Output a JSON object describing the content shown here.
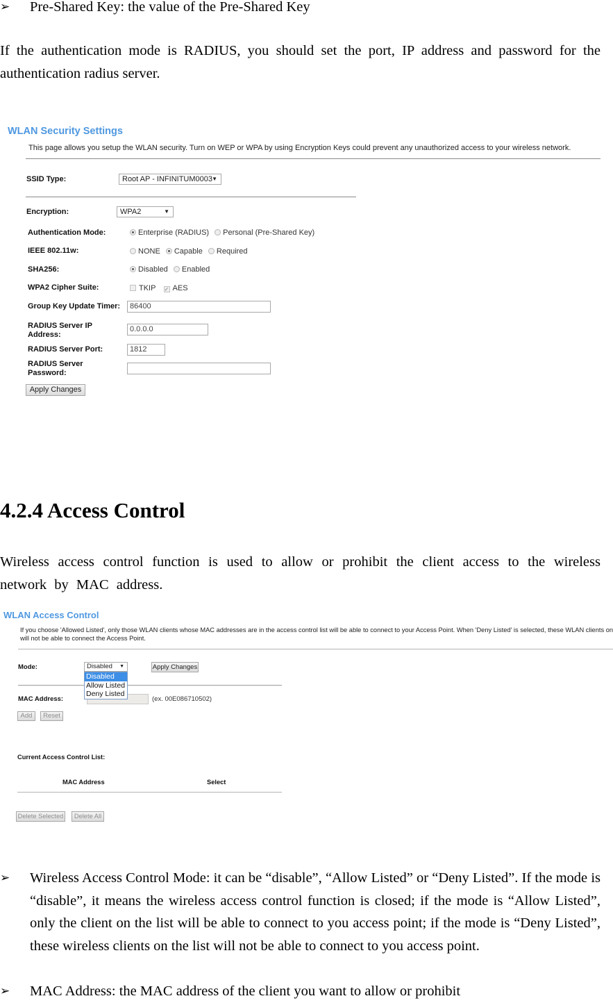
{
  "doc": {
    "bullet_glyph": "➢",
    "intro_bullet": "Pre-Shared Key: the value of the Pre-Shared Key",
    "radius_paragraph": "If the authentication mode is RADIUS, you should set the port, IP address and password for the authentication radius server.",
    "section_heading": "4.2.4 Access Control",
    "access_paragraph": "Wireless access control function is used to allow or prohibit the client access to the wireless network by MAC address.",
    "bullets": [
      "Wireless Access Control Mode: it can be “disable”, “Allow Listed” or “Deny Listed”. If the mode is “disable”, it means the wireless access control function is closed; if the mode is “Allow Listed”, only the client on the list will be able to connect to you access point; if the mode is “Deny Listed”, these wireless clients on the list will not be able to connect to you access point.",
      "MAC Address: the MAC address of the client you want to allow or prohibit"
    ]
  },
  "security": {
    "title": "WLAN Security Settings",
    "description": "This page allows you setup the WLAN security. Turn on WEP or WPA by using Encryption Keys could prevent any unauthorized access to your wireless network.",
    "ssid_type": {
      "label": "SSID Type:",
      "value": "Root AP - INFINITUM0003"
    },
    "encryption": {
      "label": "Encryption:",
      "value": "WPA2"
    },
    "auth_mode": {
      "label": "Authentication Mode:",
      "options": [
        "Enterprise (RADIUS)",
        "Personal (Pre-Shared Key)"
      ],
      "selected": 0
    },
    "ieee80211w": {
      "label": "IEEE 802.11w:",
      "options": [
        "NONE",
        "Capable",
        "Required"
      ],
      "selected": 1
    },
    "sha256": {
      "label": "SHA256:",
      "options": [
        "Disabled",
        "Enabled"
      ],
      "selected": 0
    },
    "cipher_suite": {
      "label": "WPA2 Cipher Suite:",
      "options": [
        "TKIP",
        "AES"
      ],
      "checked": [
        false,
        true
      ]
    },
    "group_key_timer": {
      "label": "Group Key Update Timer:",
      "value": "86400"
    },
    "radius_ip": {
      "label_line1": "RADIUS Server IP",
      "label_line2": "Address:",
      "value": "0.0.0.0"
    },
    "radius_port": {
      "label": "RADIUS Server Port:",
      "value": "1812"
    },
    "radius_password": {
      "label_line1": "RADIUS Server",
      "label_line2": "Password:",
      "value": ""
    },
    "apply_button": "Apply Changes"
  },
  "access_control": {
    "title": "WLAN Access Control",
    "description_line1": "If you choose 'Allowed Listed', only those WLAN clients whose MAC addresses are in the access control list will be able to connect to your Access Point. When 'Deny Listed' is selected, these WLAN clients on the list",
    "description_line2": "will not be able to connect the Access Point.",
    "mode": {
      "label": "Mode:",
      "value": "Disabled",
      "options": [
        "Disabled",
        "Allow Listed",
        "Deny Listed"
      ],
      "highlighted": 0
    },
    "apply_button": "Apply Changes",
    "mac_address": {
      "label": "MAC Address:",
      "value": "",
      "hint": "(ex. 00E086710502)"
    },
    "add_button": "Add",
    "reset_button": "Reset",
    "list_title": "Current Access Control List:",
    "table_headers": [
      "MAC Address",
      "Select"
    ],
    "rows": [],
    "delete_selected_button": "Delete Selected",
    "delete_all_button": "Delete All"
  },
  "colors": {
    "ui_title": "#4f98e0",
    "dropdown_highlight": "#3d8ee6"
  }
}
